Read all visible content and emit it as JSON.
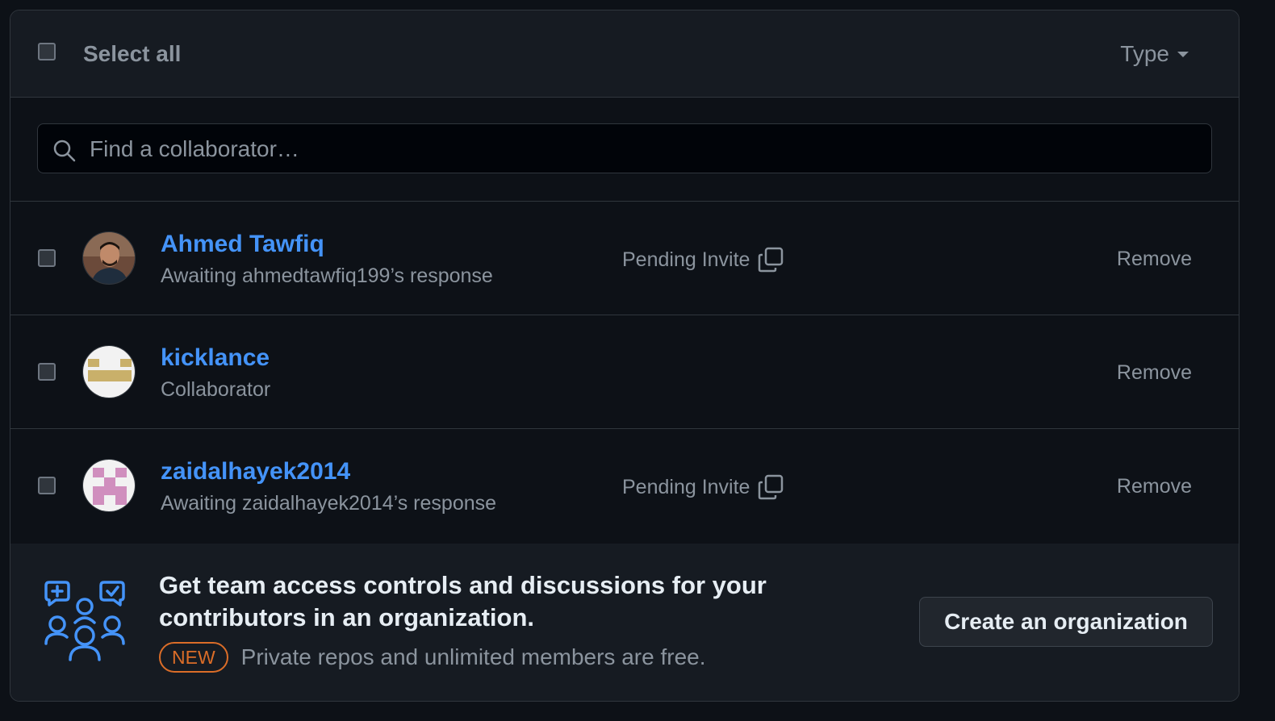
{
  "header": {
    "select_all_label": "Select all",
    "type_filter_label": "Type"
  },
  "search": {
    "placeholder": "Find a collaborator…",
    "value": ""
  },
  "collaborators": [
    {
      "name": "Ahmed Tawfiq",
      "subtitle": "Awaiting ahmedtawfiq199’s response",
      "status": "Pending Invite",
      "action": "Remove",
      "avatar": "photo"
    },
    {
      "name": "kicklance",
      "subtitle": "Collaborator",
      "status": "",
      "action": "Remove",
      "avatar": "identicon-gold"
    },
    {
      "name": "zaidalhayek2014",
      "subtitle": "Awaiting zaidalhayek2014’s response",
      "status": "Pending Invite",
      "action": "Remove",
      "avatar": "identicon-pink"
    }
  ],
  "promo": {
    "title": "Get team access controls and discussions for your contributors in an organization.",
    "badge": "NEW",
    "text": "Private repos and unlimited members are free.",
    "button_label": "Create an organization"
  },
  "colors": {
    "background": "#0d1117",
    "surface": "#161b22",
    "link": "#4493f8",
    "muted": "#8b949e",
    "badge": "#db6d28"
  },
  "icons": {
    "search": "search-icon",
    "copy": "copy-icon",
    "organization": "people-icon",
    "dropdown": "caret-down-icon"
  }
}
